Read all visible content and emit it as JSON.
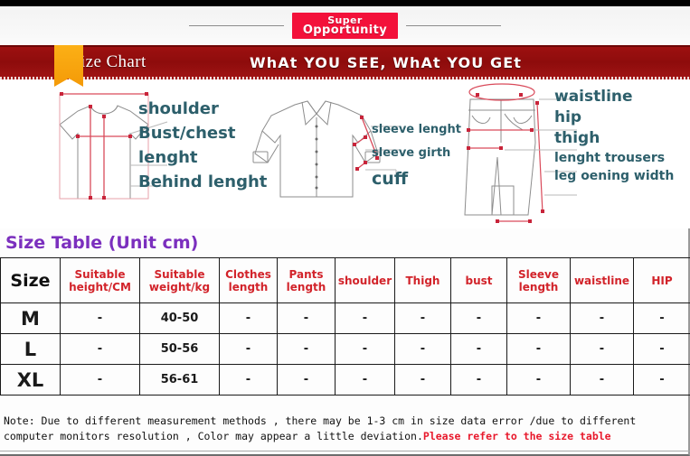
{
  "brand": {
    "logo_line1": "Super",
    "logo_line2": "Opportunity"
  },
  "banner": {
    "title": "Size Chart",
    "slogan": "WhAt YOU SEE, WhAt YOU GEt"
  },
  "diagrams": {
    "tshirt": {
      "name": "tshirt-diagram",
      "labels": [
        "shoulder",
        "Bust/chest",
        "lenght",
        "Behind lenght"
      ]
    },
    "shirt": {
      "name": "shirt-diagram",
      "labels": [
        "sleeve lenght",
        "sleeve girth",
        "cuff"
      ]
    },
    "pants": {
      "name": "pants-diagram",
      "labels": [
        "waistline",
        "hip",
        "thigh",
        "lenght trousers",
        "leg oening width"
      ]
    }
  },
  "size_table": {
    "title": "Size Table (Unit cm)",
    "columns": [
      "Size",
      "Suitable height/CM",
      "Suitable weight/kg",
      "Clothes length",
      "Pants length",
      "shoulder",
      "Thigh",
      "bust",
      "Sleeve length",
      "waistline",
      "HIP"
    ],
    "rows": [
      {
        "size": "M",
        "suitable_height": "-",
        "suitable_weight": "40-50",
        "clothes_length": "-",
        "pants_length": "-",
        "shoulder": "-",
        "thigh": "-",
        "bust": "-",
        "sleeve_length": "-",
        "waistline": "-",
        "hip": "-"
      },
      {
        "size": "L",
        "suitable_height": "-",
        "suitable_weight": "50-56",
        "clothes_length": "-",
        "pants_length": "-",
        "shoulder": "-",
        "thigh": "-",
        "bust": "-",
        "sleeve_length": "-",
        "waistline": "-",
        "hip": "-"
      },
      {
        "size": "XL",
        "suitable_height": "-",
        "suitable_weight": "56-61",
        "clothes_length": "-",
        "pants_length": "-",
        "shoulder": "-",
        "thigh": "-",
        "bust": "-",
        "sleeve_length": "-",
        "waistline": "-",
        "hip": "-"
      }
    ]
  },
  "note": {
    "line1": "Note: Due to different measurement methods , there may be 1-3 cm in size data error /due to different",
    "line2_plain": "computer monitors resolution , Color may appear a little deviation.",
    "line2_red": "Please refer to the size table"
  },
  "colors": {
    "banner_red": "#8e0c0c",
    "ribbon_orange": "#f49a07",
    "logo_red": "#f3113a",
    "label_teal": "#2d5f6b",
    "title_purple": "#7b2fbe",
    "header_red": "#d2232a",
    "note_red": "#e8192c",
    "measure_red": "#e05a67"
  }
}
